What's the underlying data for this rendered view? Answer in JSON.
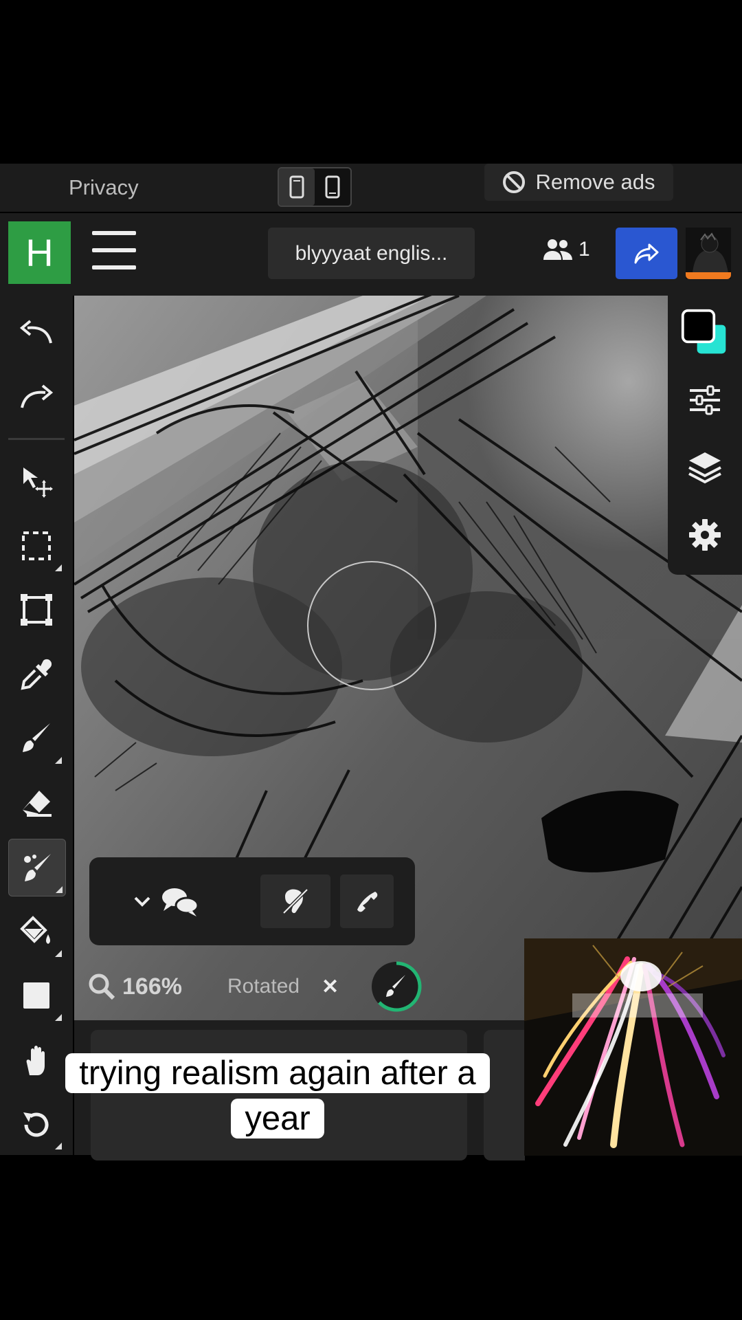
{
  "topbar": {
    "privacy_label": "Privacy",
    "remove_ads_label": "Remove ads"
  },
  "appbar": {
    "logo_letter": "H",
    "document_title": "blyyyaat englis...",
    "users_count": "1",
    "accent_color": "#2a57d1",
    "logo_color": "#2e9d44"
  },
  "left_tools": [
    {
      "name": "undo-icon"
    },
    {
      "name": "redo-icon"
    },
    {
      "name": "move-icon"
    },
    {
      "name": "select-icon"
    },
    {
      "name": "transform-icon"
    },
    {
      "name": "eyedropper-icon"
    },
    {
      "name": "brush-icon"
    },
    {
      "name": "eraser-icon"
    },
    {
      "name": "smudge-icon"
    },
    {
      "name": "fill-icon"
    },
    {
      "name": "shape-icon"
    },
    {
      "name": "hand-icon"
    },
    {
      "name": "rotate-icon"
    }
  ],
  "right_tools": {
    "primary_color": "#000000",
    "secondary_color": "#27e3d3"
  },
  "status": {
    "zoom": "166%",
    "rotated_label": "Rotated",
    "rotated_close": "✕"
  },
  "caption": {
    "line1": "trying realism again after a",
    "line2": "year"
  }
}
